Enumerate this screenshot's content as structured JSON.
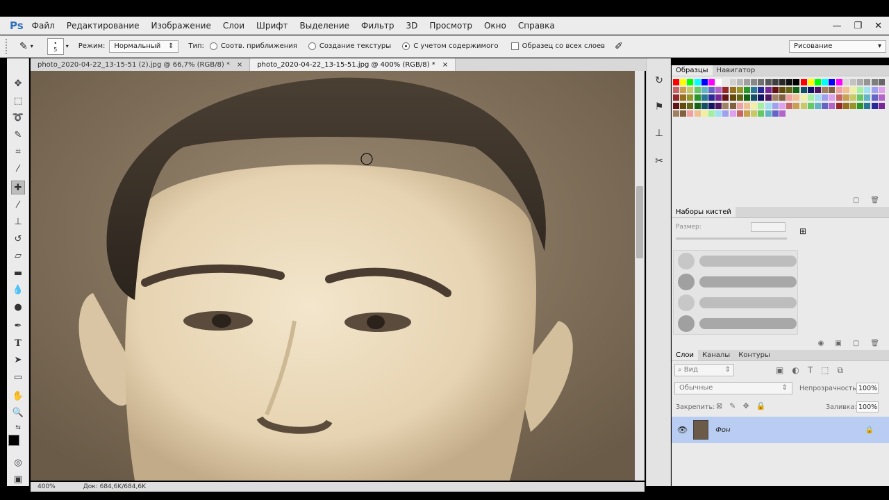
{
  "app": {
    "logo": "Ps"
  },
  "menu": [
    "Файл",
    "Редактирование",
    "Изображение",
    "Слои",
    "Шрифт",
    "Выделение",
    "Фильтр",
    "3D",
    "Просмотр",
    "Окно",
    "Справка"
  ],
  "window_controls": {
    "minimize": "—",
    "restore": "❐",
    "close": "✕"
  },
  "options": {
    "brush_size_top": "•",
    "brush_size": "5",
    "mode_label": "Режим:",
    "mode_value": "Нормальный",
    "type_label": "Тип:",
    "type_options": [
      "Соотв. приближения",
      "Создание текстуры",
      "С учетом содержимого"
    ],
    "sample_all_label": "Образец со всех слоев",
    "workspace": "Рисование"
  },
  "tabs": [
    {
      "label": "photo_2020-04-22_13-15-51 (2).jpg @ 66,7% (RGB/8) *",
      "close": "×"
    },
    {
      "label": "photo_2020-04-22_13-15-51.jpg @ 400% (RGB/8) *",
      "close": "×"
    }
  ],
  "status": {
    "zoom": "400%",
    "doc": "Док: 684,6K/684,6K"
  },
  "swatches_panel": {
    "tabs": [
      "Образцы",
      "Навигатор"
    ]
  },
  "brushes_panel": {
    "title": "Наборы кистей",
    "size_label": "Размер:"
  },
  "layers_panel": {
    "tabs": [
      "Слои",
      "Каналы",
      "Контуры"
    ],
    "search_label": "Вид",
    "blend_mode": "Обычные",
    "opacity_label": "Непрозрачность:",
    "opacity_value": "100%",
    "lock_label": "Закрепить:",
    "fill_label": "Заливка:",
    "fill_value": "100%",
    "layer_name": "Фон"
  },
  "colors": {
    "swatches": [
      "#ff0000",
      "#ffff00",
      "#00ff00",
      "#00ffff",
      "#0000ff",
      "#ff00ff",
      "#ffffff",
      "#e8e8e8",
      "#d0d0d0",
      "#b8b8b8",
      "#a0a0a0",
      "#888888",
      "#707070",
      "#585858",
      "#404040",
      "#282828",
      "#101010",
      "#000000",
      "#ff0000",
      "#ffff00",
      "#00ff00",
      "#00ffff",
      "#0000ff",
      "#ff00ff",
      "#d9d9d9",
      "#c2c2c2",
      "#acacac",
      "#959595",
      "#7e7e7e",
      "#676767"
    ]
  }
}
